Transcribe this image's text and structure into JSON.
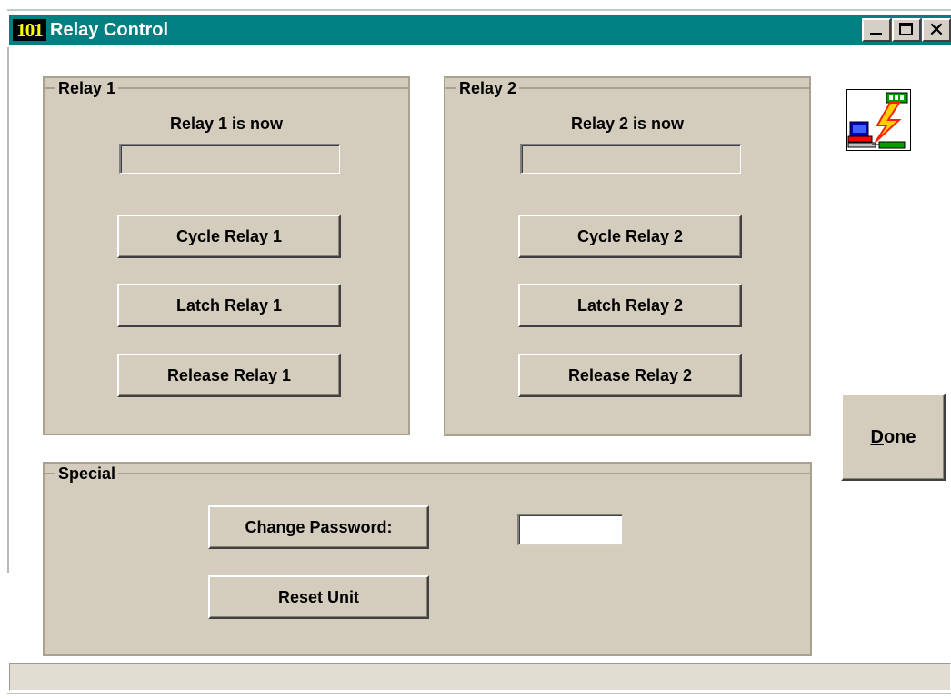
{
  "window": {
    "app_icon_text": "101",
    "title": "Relay Control",
    "controls": {
      "minimize_icon": "minimize-icon",
      "maximize_icon": "maximize-icon",
      "close_icon": "close-icon",
      "close_glyph": "✕"
    },
    "titlebar_color": "#008080"
  },
  "relay1": {
    "group_title": "Relay 1",
    "status_caption": "Relay 1 is now",
    "status_value": "",
    "buttons": {
      "cycle": "Cycle Relay 1",
      "latch": "Latch Relay 1",
      "release": "Release Relay 1"
    }
  },
  "relay2": {
    "group_title": "Relay 2",
    "status_caption": "Relay 2 is now",
    "status_value": "",
    "buttons": {
      "cycle": "Cycle Relay 2",
      "latch": "Latch Relay 2",
      "release": "Release Relay 2"
    }
  },
  "special": {
    "group_title": "Special",
    "change_password_label": "Change Password:",
    "password_value": "",
    "reset_unit_label": "Reset Unit"
  },
  "done": {
    "mnemonic": "D",
    "rest": "one"
  },
  "status_icon": "network-relay-icon",
  "statusbar": {
    "text": ""
  },
  "colors": {
    "panel": "#d4ccbc",
    "accent": "#008080",
    "app_icon_text": "#ffff00"
  }
}
